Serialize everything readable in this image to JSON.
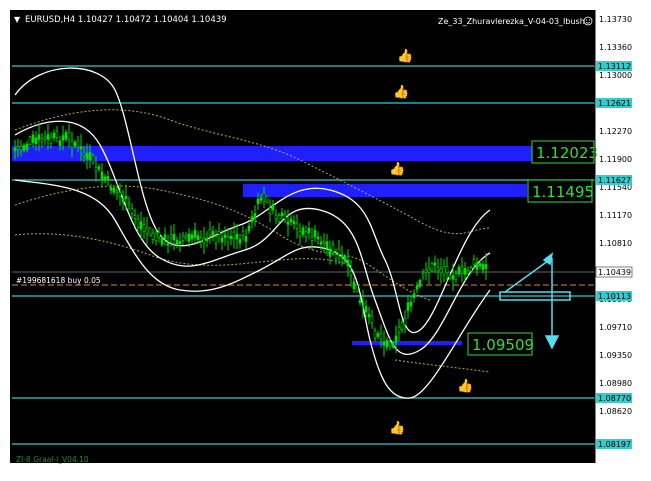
{
  "header": {
    "collapse_glyph": "▼",
    "symbol_ohlc": "EURUSD,H4  1.10427 1.10472 1.10404 1.10439",
    "indicator_name": "Ze_33_Zhuravlerezka_V-04-03_Ibush",
    "smiley_icon": "smiley-icon"
  },
  "order_line": {
    "label": "#199681618 buy 0.05"
  },
  "footer_indicator": "ZI-8 Graal-I_V04.10",
  "price_axis": {
    "ticks": [
      "1.13730",
      "1.13360",
      "1.13000",
      "1.12270",
      "1.11900",
      "1.11540",
      "1.11170",
      "1.10810",
      "1.10079",
      "1.09710",
      "1.09350",
      "1.08980",
      "1.08620"
    ],
    "tags": {
      "current": "1.10439",
      "cyan_1": "1.13112",
      "cyan_2": "1.12621",
      "cyan_3": "1.11627",
      "cyan_4": "1.10113",
      "cyan_5": "1.08770",
      "cyan_6": "1.08197"
    }
  },
  "zone_labels": {
    "zone_top": "1.12023",
    "zone_mid": "1.11495",
    "zone_low": "1.09509"
  },
  "colors": {
    "background": "#000000",
    "candle": "#00e000",
    "band": "#ffffff",
    "level_cyan": "#33cccc",
    "zone_blue": "#2020ff",
    "label_green": "#33dd33",
    "arrow": "#55ddee",
    "dotted": "#b8b040"
  },
  "icons": [
    "thumb-up-icon"
  ]
}
